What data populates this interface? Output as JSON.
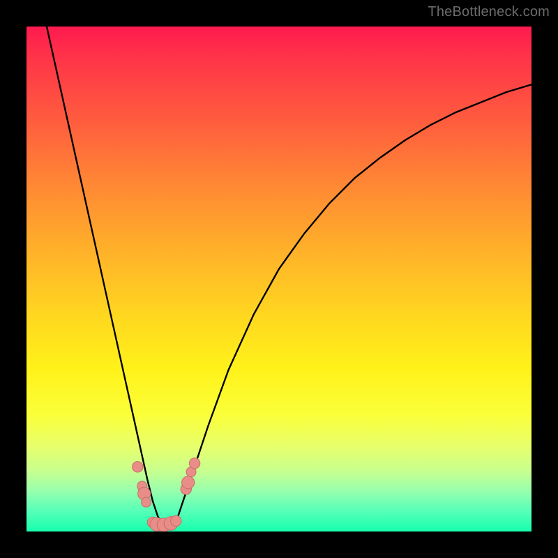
{
  "watermark": {
    "text": "TheBottleneck.com"
  },
  "colors": {
    "background": "#000000",
    "curve": "#000000",
    "marker_fill": "#e98d88",
    "marker_stroke": "#c96b66",
    "gradient_stops": [
      "#ff1a4f",
      "#ff3348",
      "#ff5a3f",
      "#ff8a33",
      "#ffb329",
      "#ffd91f",
      "#fff21a",
      "#faff3a",
      "#e8ff6a",
      "#c8ff8f",
      "#97ffad",
      "#55ffb8",
      "#17ffad"
    ]
  },
  "chart_data": {
    "type": "line",
    "title": "",
    "xlabel": "",
    "ylabel": "",
    "xlim": [
      0,
      100
    ],
    "ylim": [
      0,
      100
    ],
    "grid": false,
    "description": "V-shaped bottleneck curve; minimum near x≈27; y is bottleneck % (0=green, 100=red).",
    "series": [
      {
        "name": "bottleneck-curve",
        "x": [
          4,
          6,
          8,
          10,
          12,
          14,
          16,
          18,
          20,
          22,
          24,
          25,
          26,
          27,
          28,
          29,
          30,
          31,
          33,
          36,
          40,
          45,
          50,
          55,
          60,
          65,
          70,
          75,
          80,
          85,
          90,
          95,
          100
        ],
        "y": [
          100,
          91,
          82,
          73,
          64,
          55,
          46,
          37,
          28,
          19,
          10,
          6,
          3,
          1.5,
          1.2,
          1.5,
          3,
          6,
          12,
          21,
          32,
          43,
          52,
          59,
          65,
          70,
          74,
          77.5,
          80.5,
          83,
          85,
          87,
          88.5
        ]
      }
    ],
    "markers": [
      {
        "x": 22.0,
        "y": 12.8,
        "r": 1.1
      },
      {
        "x": 22.9,
        "y": 9.0,
        "r": 1.0
      },
      {
        "x": 23.3,
        "y": 7.5,
        "r": 1.3
      },
      {
        "x": 23.7,
        "y": 5.8,
        "r": 1.0
      },
      {
        "x": 25.0,
        "y": 1.8,
        "r": 1.1
      },
      {
        "x": 25.8,
        "y": 1.4,
        "r": 1.4
      },
      {
        "x": 27.2,
        "y": 1.3,
        "r": 1.4
      },
      {
        "x": 28.6,
        "y": 1.6,
        "r": 1.4
      },
      {
        "x": 29.6,
        "y": 2.1,
        "r": 1.1
      },
      {
        "x": 31.6,
        "y": 8.4,
        "r": 1.1
      },
      {
        "x": 32.0,
        "y": 9.7,
        "r": 1.3
      },
      {
        "x": 32.6,
        "y": 11.8,
        "r": 1.0
      },
      {
        "x": 33.3,
        "y": 13.5,
        "r": 1.1
      }
    ]
  }
}
